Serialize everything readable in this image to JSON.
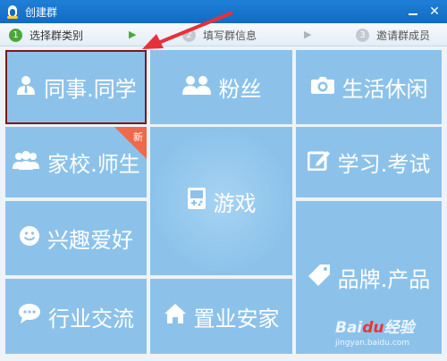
{
  "window": {
    "title": "创建群",
    "minimize_symbol": "–",
    "close_symbol": "✕"
  },
  "steps": [
    {
      "num": "1",
      "label": "选择群类别",
      "state": "active"
    },
    {
      "num": "2",
      "label": "填写群信息",
      "state": "inactive"
    },
    {
      "num": "3",
      "label": "邀请群成员",
      "state": "inactive"
    }
  ],
  "step_arrow": "▶",
  "categories": {
    "colleague": {
      "label": "同事.同学",
      "icon": "person-icon",
      "selected": true
    },
    "fans": {
      "label": "粉丝",
      "icon": "people-icon"
    },
    "life": {
      "label": "生活休闲",
      "icon": "camera-icon"
    },
    "family": {
      "label": "家校.师生",
      "icon": "group-icon",
      "badge": "新"
    },
    "study": {
      "label": "学习.考试",
      "icon": "edit-icon"
    },
    "game": {
      "label": "游戏",
      "icon": "gameboy-icon"
    },
    "hobby": {
      "label": "兴趣爱好",
      "icon": "smile-icon"
    },
    "brand": {
      "label": "品牌.产品",
      "icon": "tag-icon"
    },
    "industry": {
      "label": "行业交流",
      "icon": "chat-icon"
    },
    "realestate": {
      "label": "置业安家",
      "icon": "home-icon"
    }
  },
  "watermark": {
    "logo_prefix": "Bai",
    "logo_mid": "du",
    "logo_suffix": "经验",
    "url": "jingyan.baidu.com"
  },
  "colors": {
    "tile": "#8cc2ea",
    "titlebar": "#136bc2",
    "active_step": "#4aa83b",
    "badge": "#ee6a4a",
    "selection": "#7a1a1a",
    "annotation_arrow": "#e8303a"
  }
}
